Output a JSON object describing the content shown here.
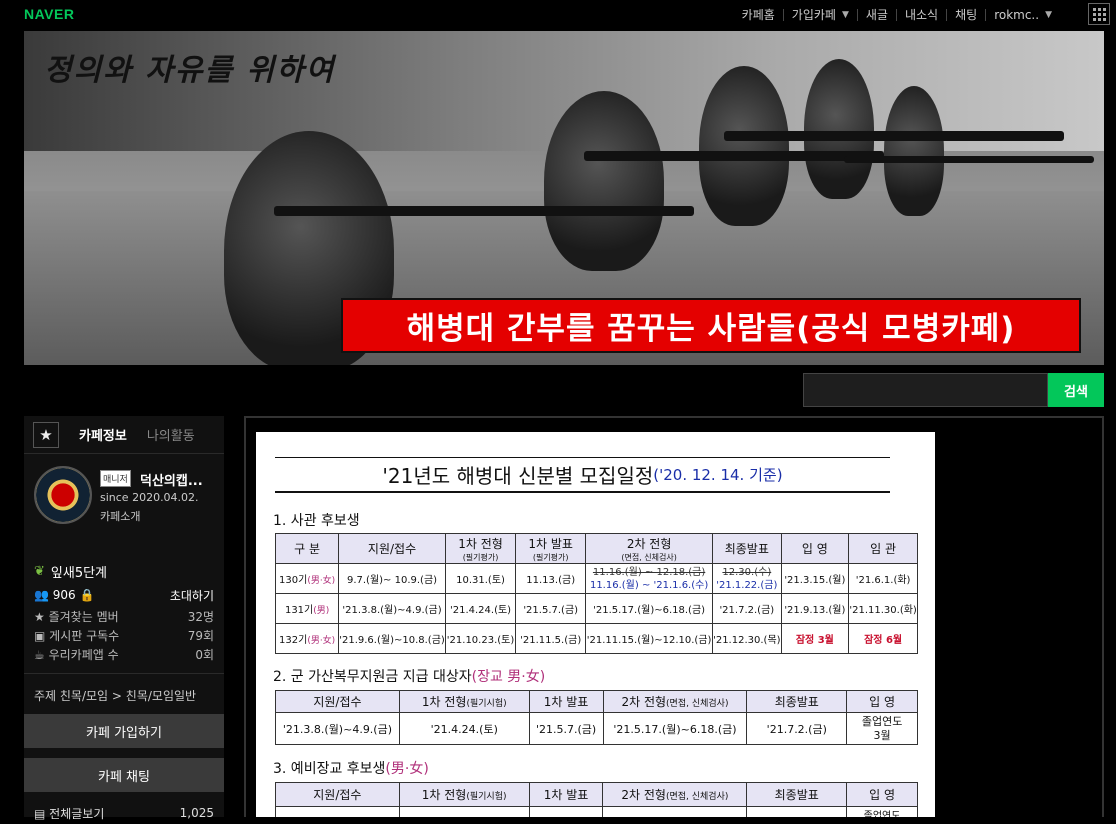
{
  "gnb": {
    "logo": "NAVER",
    "menu": [
      "카페홈",
      "가입카페",
      "새글",
      "내소식",
      "채팅",
      "rokmc.."
    ]
  },
  "banner": {
    "slogan": "정의와 자유를 위하여",
    "headline": "해병대 간부를 꿈꾸는 사람들(공식 모병카페)"
  },
  "search": {
    "button": "검색",
    "placeholder": ""
  },
  "sidebar": {
    "tab_info": "카페정보",
    "tab_activity": "나의활동",
    "manager_badge": "매니저",
    "manager_name": "덕산의캡...",
    "since": "since 2020.04.02.",
    "intro": "카페소개",
    "level": "잎새5단계",
    "members": "906",
    "invite": "초대하기",
    "stats": [
      {
        "label": "즐겨찾는 멤버",
        "value": "32명"
      },
      {
        "label": "게시판 구독수",
        "value": "79회"
      },
      {
        "label": "우리카페앱 수",
        "value": "0회"
      }
    ],
    "category": "주제 친목/모임 > 친목/모임일반",
    "join_button": "카페 가입하기",
    "chat_button": "카페 채팅",
    "all_posts": "전체글보기",
    "all_posts_count": "1,025"
  },
  "doc": {
    "title": "'21년도 해병대 신분별 모집일정",
    "title_date": "('20. 12. 14. 기준)",
    "sec1": "1. 사관 후보생",
    "sec2": "2. 군 가산복무지원금 지급 대상자",
    "sec2_note": "(장교 男·女)",
    "sec3": "3. 예비장교 후보생",
    "sec3_note": "(男·女)",
    "t1_headers": [
      "구 분",
      "지원/접수",
      "1차 전형",
      "1차 발표",
      "2차 전형",
      "최종발표",
      "입 영",
      "임 관"
    ],
    "t1_sub": [
      "",
      "",
      "(필기평가)",
      "(필기평가)",
      "(면접, 신체검사)",
      "",
      "",
      ""
    ],
    "t1_rows": [
      [
        "130기",
        "(男·女)",
        "9.7.(월)~ 10.9.(금)",
        "10.31.(토)",
        "11.13.(금)",
        "11.16.(월) ~ 12.18.(금)",
        "11.16.(월) ~ '21.1.6.(수)",
        "12.30.(수)",
        "'21.1.22.(금)",
        "'21.3.15.(월)",
        "'21.6.1.(화)"
      ],
      [
        "131기",
        "(男)",
        "'21.3.8.(월)~4.9.(금)",
        "'21.4.24.(토)",
        "'21.5.7.(금)",
        "'21.5.17.(월)~6.18.(금)",
        "",
        "'21.7.2.(금)",
        "",
        "'21.9.13.(월)",
        "'21.11.30.(화)"
      ],
      [
        "132기",
        "(男·女)",
        "'21.9.6.(월)~10.8.(금)",
        "'21.10.23.(토)",
        "'21.11.5.(금)",
        "'21.11.15.(월)~12.10.(금)",
        "",
        "'21.12.30.(목)",
        "",
        "잠정 3월",
        "잠정 6월"
      ]
    ],
    "t2_headers": [
      "지원/접수",
      "1차 전형",
      "1차 발표",
      "2차 전형",
      "최종발표",
      "입 영"
    ],
    "t2_header_notes": [
      "",
      "(필기시험)",
      "",
      "(면접, 신체검사)",
      "",
      ""
    ],
    "t2_row": [
      "'21.3.8.(월)~4.9.(금)",
      "'21.4.24.(토)",
      "'21.5.7.(금)",
      "'21.5.17.(월)~6.18.(금)",
      "'21.7.2.(금)",
      "졸업연도",
      "3월"
    ],
    "t3_headers": [
      "지원/접수",
      "1차 전형",
      "1차 발표",
      "2차 전형",
      "최종발표",
      "입 영"
    ],
    "t3_header_notes": [
      "",
      "(필기시험)",
      "",
      "(면접, 신체검사)",
      "",
      ""
    ],
    "t3_row_partial": "졸업연도"
  }
}
